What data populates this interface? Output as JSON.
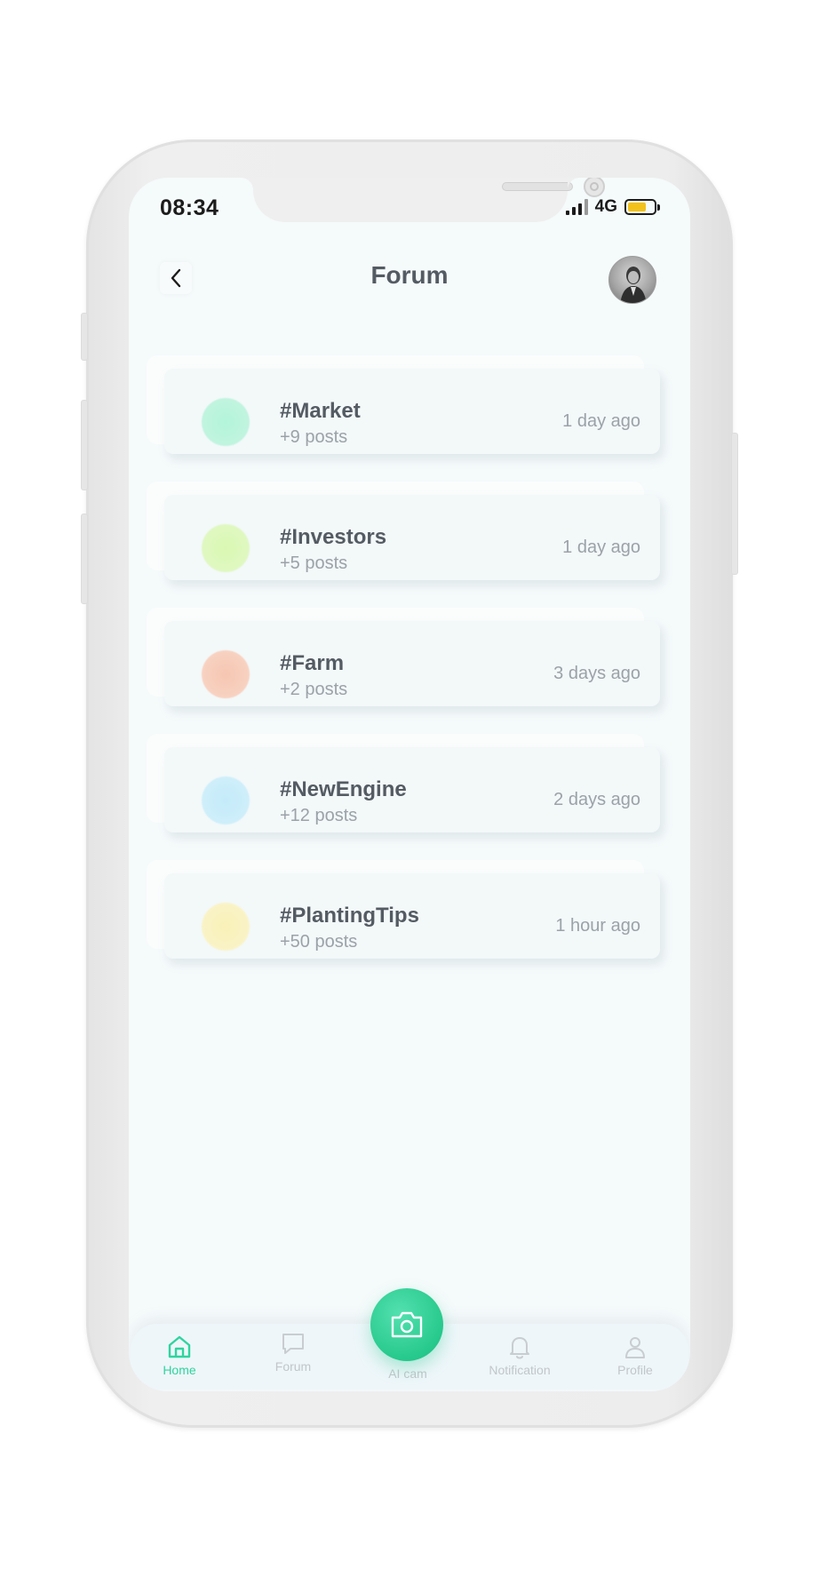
{
  "status_bar": {
    "time": "08:34",
    "network": "4G"
  },
  "header": {
    "title": "Forum"
  },
  "topics": [
    {
      "name": "#Market",
      "posts": "+9 posts",
      "time": "1 day ago",
      "color": "#9ff2cf"
    },
    {
      "name": "#Investors",
      "posts": "+5 posts",
      "time": "1 day ago",
      "color": "#d4f8a4"
    },
    {
      "name": "#Farm",
      "posts": "+2 posts",
      "time": "3 days ago",
      "color": "#f8c4ad"
    },
    {
      "name": "#NewEngine",
      "posts": "+12 posts",
      "time": "2 days ago",
      "color": "#bfeafa"
    },
    {
      "name": "#PlantingTips",
      "posts": "+50 posts",
      "time": "1 hour ago",
      "color": "#fbf1b2"
    }
  ],
  "bottom_nav": {
    "home": "Home",
    "forum": "Forum",
    "ai_cam": "AI cam",
    "notification": "Notification",
    "profile": "Profile",
    "accent_color": "#2fd49d"
  }
}
